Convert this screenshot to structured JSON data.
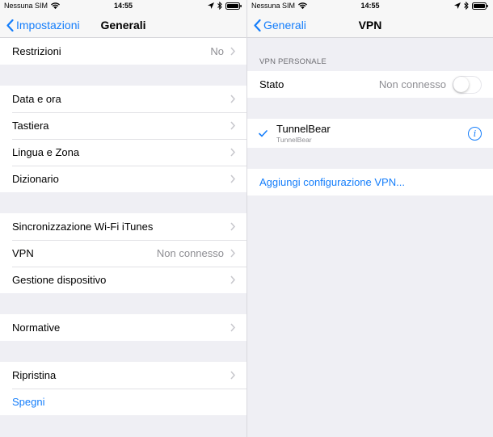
{
  "status_left": {
    "carrier": "Nessuna SIM",
    "time": "14:55"
  },
  "status_right": {
    "carrier": "Nessuna SIM",
    "time": "14:55"
  },
  "left_screen": {
    "nav": {
      "back_label": "Impostazioni",
      "title": "Generali"
    },
    "groups": [
      [
        {
          "label": "Restrizioni",
          "value": "No"
        }
      ],
      [
        {
          "label": "Data e ora"
        },
        {
          "label": "Tastiera"
        },
        {
          "label": "Lingua e Zona"
        },
        {
          "label": "Dizionario"
        }
      ],
      [
        {
          "label": "Sincronizzazione Wi-Fi iTunes"
        },
        {
          "label": "VPN",
          "value": "Non connesso"
        },
        {
          "label": "Gestione dispositivo"
        }
      ],
      [
        {
          "label": "Normative"
        }
      ],
      [
        {
          "label": "Ripristina"
        },
        {
          "label": "Spegni"
        }
      ]
    ]
  },
  "right_screen": {
    "nav": {
      "back_label": "Generali",
      "title": "VPN"
    },
    "section_header": "VPN PERSONALE",
    "status_row": {
      "label": "Stato",
      "value": "Non connesso",
      "toggle_on": false
    },
    "vpn_config": {
      "name": "TunnelBear",
      "subtitle": "TunnelBear",
      "selected": true
    },
    "add_link": "Aggiungi configurazione VPN..."
  },
  "colors": {
    "accent": "#157efb",
    "background": "#efeff4",
    "secondary_text": "#8e8e93"
  }
}
